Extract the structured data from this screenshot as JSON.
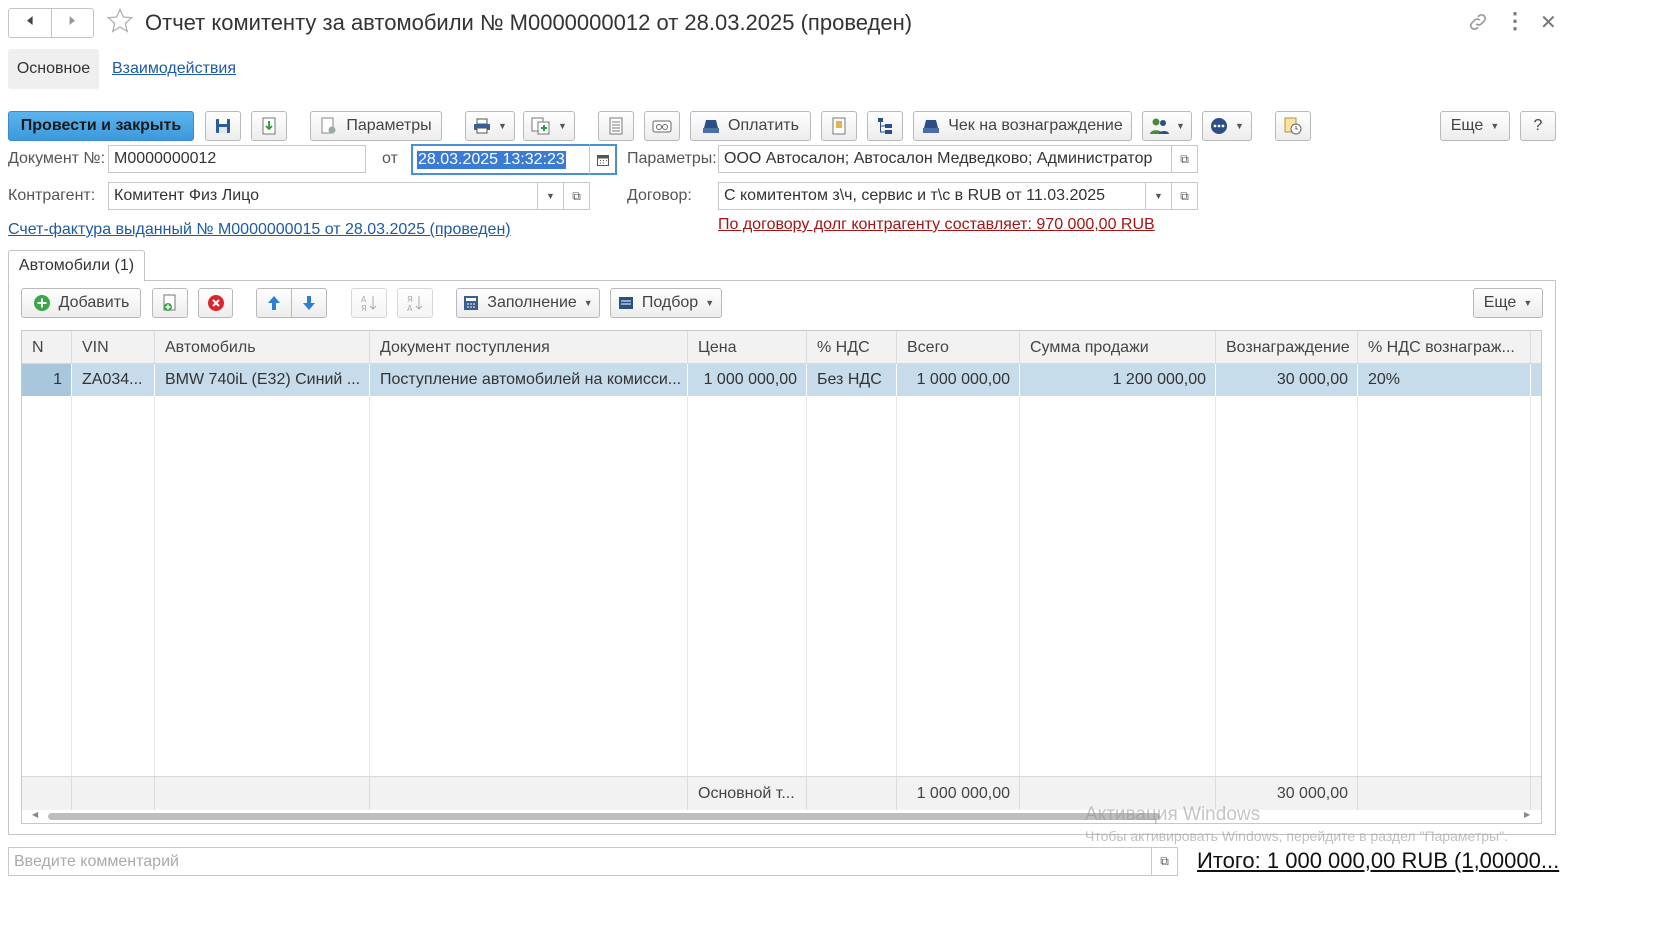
{
  "window": {
    "title": "Отчет комитенту за автомобили № М0000000012 от 28.03.2025 (проведен)"
  },
  "nav_tabs": [
    {
      "label": "Основное"
    },
    {
      "label": "Взаимодействия"
    }
  ],
  "toolbar": {
    "post_close": "Провести и закрыть",
    "params": "Параметры",
    "pay": "Оплатить",
    "receipt": "Чек на вознаграждение",
    "more": "Еще",
    "help": "?"
  },
  "form": {
    "doc_no_label": "Документ №:",
    "doc_no_value": "М0000000012",
    "date_label": "от",
    "date_value": "28.03.2025 13:32:23",
    "params_label": "Параметры:",
    "params_value": "ООО Автосалон; Автосалон Медведково; Администратор",
    "contractor_label": "Контрагент:",
    "contractor_value": "Комитент Физ Лицо",
    "contract_label": "Договор:",
    "contract_value": "С комитентом з\\ч, сервис и т\\с в RUB от 11.03.2025",
    "debt_text": "По договору долг контрагенту составляет: 970 000,00 RUB",
    "invoice_link": "Счет-фактура выданный № М0000000015 от 28.03.2025 (проведен)"
  },
  "section_tab": {
    "label": "Автомобили (1)"
  },
  "table_toolbar": {
    "add": "Добавить",
    "fill": "Заполнение",
    "pick": "Подбор",
    "more": "Еще"
  },
  "table": {
    "columns": [
      "N",
      "VIN",
      "Автомобиль",
      "Документ поступления",
      "Цена",
      "% НДС",
      "Всего",
      "Сумма продажи",
      "Вознаграждение",
      "% НДС вознаграж..."
    ],
    "rows": [
      {
        "n": "1",
        "vin": "ZA034...",
        "car": "BMW 740iL (E32) Синий ...",
        "doc": "Поступление автомобилей на комисси...",
        "price": "1 000 000,00",
        "vat": "Без НДС",
        "total": "1 000 000,00",
        "sale": "1 200 000,00",
        "reward": "30 000,00",
        "reward_vat": "20%"
      }
    ],
    "footer": {
      "price": "Основной т...",
      "total": "1 000 000,00",
      "reward": "30 000,00"
    }
  },
  "watermark": {
    "line1": "Активация Windows",
    "line2": "Чтобы активировать Windows, перейдите в раздел \"Параметры\"."
  },
  "bottom": {
    "comment_placeholder": "Введите комментарий",
    "total": "Итого: 1 000 000,00 RUB (1,00000..."
  },
  "colors": {
    "primary_button": "#4aa6e6",
    "selected_row": "#c6dcea",
    "link": "#1d5aa7",
    "debt": "#a31515"
  }
}
